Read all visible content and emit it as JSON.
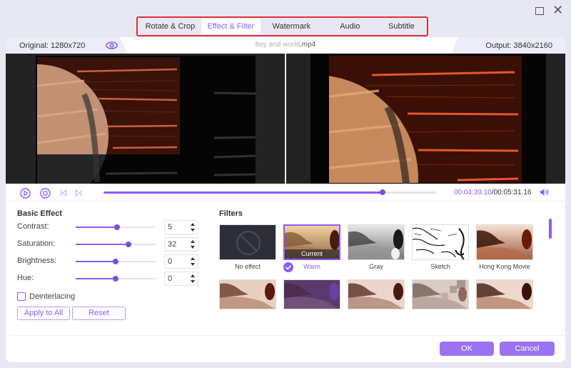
{
  "window": {
    "maximize_icon": "maximize-icon",
    "close_icon": "close-icon"
  },
  "tabs": [
    {
      "label": "Rotate & Crop",
      "active": false
    },
    {
      "label": "Effect & Filter",
      "active": true
    },
    {
      "label": "Watermark",
      "active": false
    },
    {
      "label": "Audio",
      "active": false
    },
    {
      "label": "Subtitle",
      "active": false
    }
  ],
  "infobar": {
    "original": "Original: 1280x720",
    "filename_blurred": "boy and world",
    "filename_ext": ".mp4",
    "output": "Output: 3840x2160"
  },
  "playback": {
    "current_time": "00:04:39.10",
    "separator": "/",
    "total_time": "00:05:31.16",
    "progress": 0.84
  },
  "basic_effect": {
    "title": "Basic Effect",
    "adjustments": [
      {
        "label": "Contrast:",
        "value": "5",
        "fraction": 0.52
      },
      {
        "label": "Saturation:",
        "value": "32",
        "fraction": 0.66
      },
      {
        "label": "Brightness:",
        "value": "0",
        "fraction": 0.5
      },
      {
        "label": "Hue:",
        "value": "0",
        "fraction": 0.5
      }
    ],
    "deinterlacing_label": "Deinterlacing",
    "deinterlacing_checked": false,
    "apply_all_label": "Apply to All",
    "reset_label": "Reset"
  },
  "filters": {
    "title": "Filters",
    "current_caption": "Current",
    "items": [
      {
        "name": "No effect",
        "selected": false
      },
      {
        "name": "Warm",
        "selected": true
      },
      {
        "name": "Gray",
        "selected": false
      },
      {
        "name": "Sketch",
        "selected": false
      },
      {
        "name": "Hong Kong Movie",
        "selected": false
      },
      {
        "name": "",
        "selected": false
      },
      {
        "name": "",
        "selected": false
      },
      {
        "name": "",
        "selected": false
      },
      {
        "name": "",
        "selected": false
      },
      {
        "name": "",
        "selected": false
      }
    ]
  },
  "footer": {
    "ok_label": "OK",
    "cancel_label": "Cancel"
  },
  "colors": {
    "accent": "#8b5cf6",
    "highlight_border": "#e03131",
    "background": "#e8e8f5"
  }
}
